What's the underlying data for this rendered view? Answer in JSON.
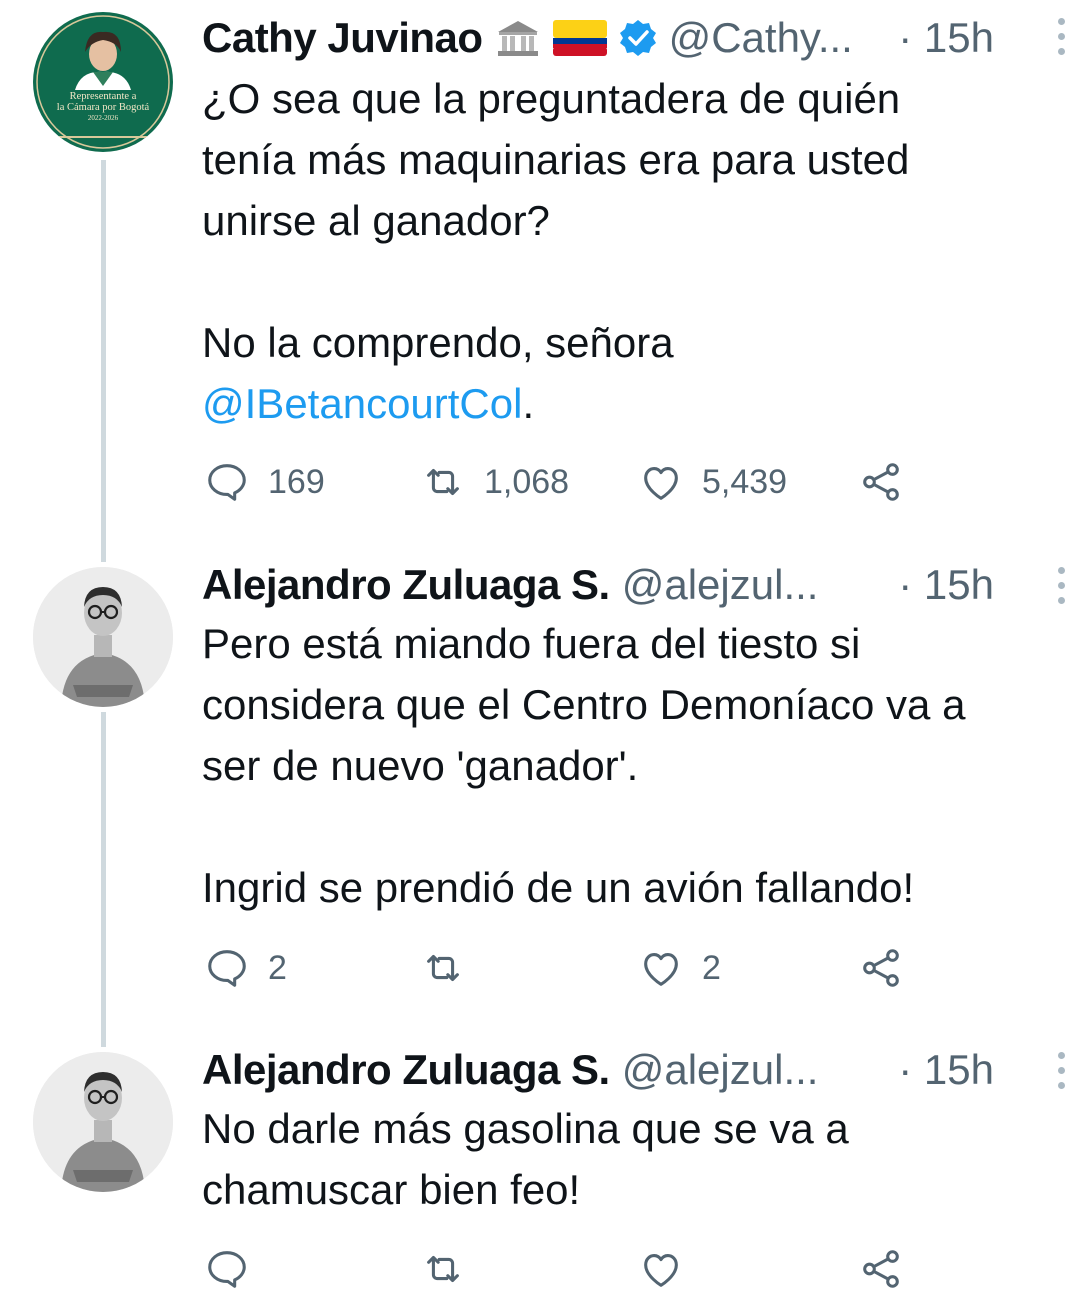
{
  "colors": {
    "accent": "#1d9bf0",
    "muted": "#536471",
    "line": "#cfd9de",
    "verified": "#1d9bf0",
    "avatar_green": "#0f6b4e"
  },
  "tweets": [
    {
      "author": "Cathy Juvinao",
      "handle": "@Cathy...",
      "sep": "·",
      "time": "15h",
      "badges": [
        "classical-building-emoji",
        "colombia-flag-emoji",
        "verified-icon"
      ],
      "avatar_text": [
        "Representante a",
        "la Cámara por Bogotá",
        "2022-2026"
      ],
      "text_p1": "¿O sea que la preguntadera de quién\ntenía más maquinarias era para usted\nunirse al ganador?",
      "text_p2_prefix": "No la comprendo, señora\n",
      "mention": "@IBetancourtCol",
      "text_p2_suffix": ".",
      "replies": "169",
      "retweets": "1,068",
      "likes": "5,439"
    },
    {
      "author": "Alejandro Zuluaga S.",
      "handle": "@alejzul...",
      "sep": "·",
      "time": "15h",
      "text_p1": "Pero está miando fuera del tiesto si\nconsidera que el Centro Demoníaco va a\nser de nuevo 'ganador'.",
      "text_p2": "Ingrid se prendió de un avión fallando!",
      "replies": "2",
      "retweets": "",
      "likes": "2"
    },
    {
      "author": "Alejandro Zuluaga S.",
      "handle": "@alejzul...",
      "sep": "·",
      "time": "15h",
      "text_p1": "No darle más gasolina que se va a\nchamuscar bien feo!",
      "replies": "",
      "retweets": "",
      "likes": ""
    }
  ]
}
